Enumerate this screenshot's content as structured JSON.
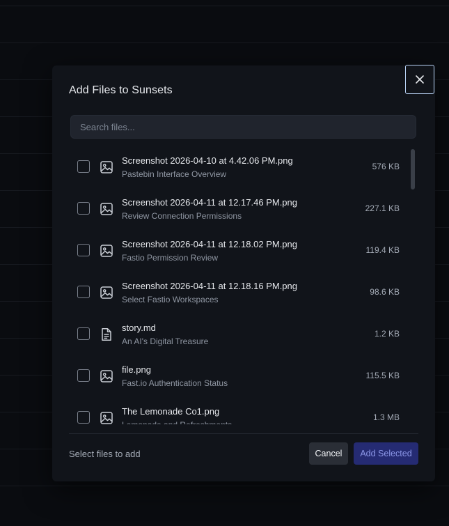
{
  "dialog": {
    "title": "Add Files to Sunsets",
    "close_icon": "close-icon",
    "search": {
      "placeholder": "Search files...",
      "value": ""
    },
    "files": [
      {
        "name": "Screenshot 2026-04-10 at 4.42.06 PM.png",
        "description": "Pastebin Interface Overview",
        "size": "576 KB",
        "icon": "image-icon",
        "checked": false
      },
      {
        "name": "Screenshot 2026-04-11 at 12.17.46 PM.png",
        "description": "Review Connection Permissions",
        "size": "227.1 KB",
        "icon": "image-icon",
        "checked": false
      },
      {
        "name": "Screenshot 2026-04-11 at 12.18.02 PM.png",
        "description": "Fastio Permission Review",
        "size": "119.4 KB",
        "icon": "image-icon",
        "checked": false
      },
      {
        "name": "Screenshot 2026-04-11 at 12.18.16 PM.png",
        "description": "Select Fastio Workspaces",
        "size": "98.6 KB",
        "icon": "image-icon",
        "checked": false
      },
      {
        "name": "story.md",
        "description": "An AI's Digital Treasure",
        "size": "1.2 KB",
        "icon": "document-icon",
        "checked": false
      },
      {
        "name": "file.png",
        "description": "Fast.io Authentication Status",
        "size": "115.5 KB",
        "icon": "image-icon",
        "checked": false
      },
      {
        "name": "The Lemonade Co1.png",
        "description": "Lemonade and Refreshments",
        "size": "1.3 MB",
        "icon": "image-icon",
        "checked": false
      }
    ],
    "footer": {
      "hint": "Select files to add",
      "cancel_label": "Cancel",
      "add_label": "Add Selected"
    }
  },
  "colors": {
    "page_background": "#0a0c10",
    "dialog_background": "#11141a",
    "search_background": "#20242d",
    "close_focus_ring": "#b9d3f5",
    "primary_button": "#252b73",
    "primary_button_text": "#8c97e8"
  }
}
